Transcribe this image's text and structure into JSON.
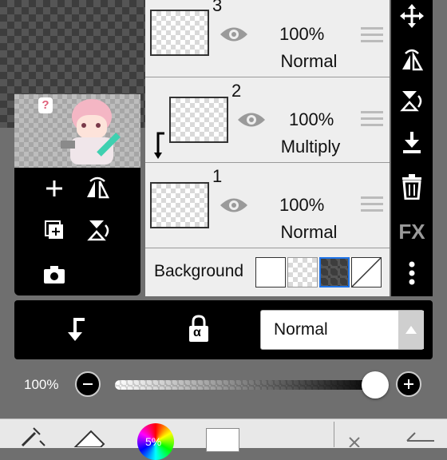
{
  "layers": [
    {
      "number": "3",
      "opacity": "100%",
      "blend": "Normal"
    },
    {
      "number": "2",
      "opacity": "100%",
      "blend": "Multiply"
    },
    {
      "number": "1",
      "opacity": "100%",
      "blend": "Normal"
    }
  ],
  "background_label": "Background",
  "blend_mode_select": "Normal",
  "opacity_slider": {
    "label": "100%",
    "value": 1.0
  },
  "color_wheel_label": "5%",
  "colors": {
    "panel": "#000000",
    "row": "#eeeeee",
    "accent": "#ffffff",
    "toolbar": "#e8e8e8"
  },
  "icons": {
    "right_tools": [
      "move-icon",
      "flip-horizontal-icon",
      "flip-vertical-icon",
      "merge-down-icon",
      "trash-icon",
      "fx-icon",
      "more-icon"
    ],
    "left_tools": [
      "add-layer-icon",
      "flip-icon",
      "copy-layer-icon",
      "rotate-icon",
      "camera-icon"
    ]
  },
  "fx_label": "FX",
  "alpha_lock_label": "α"
}
